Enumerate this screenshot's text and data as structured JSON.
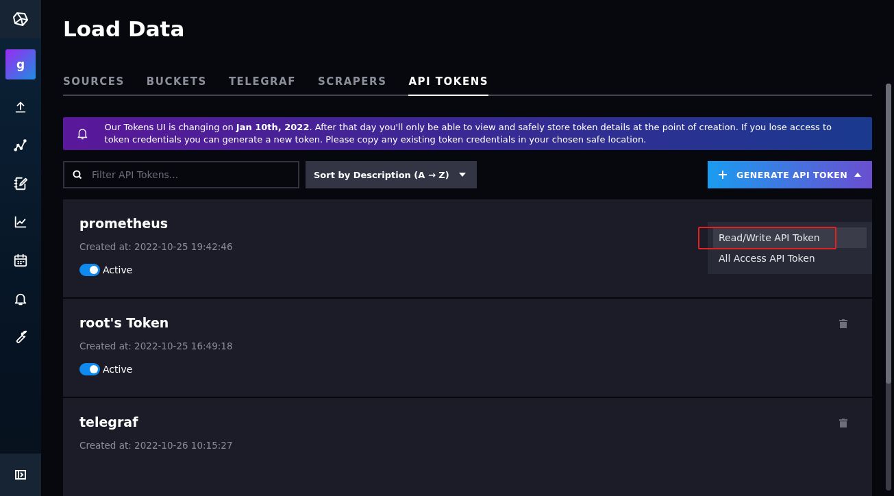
{
  "sidebar": {
    "avatar": "g",
    "items": [
      {
        "kind": "upload",
        "selected": false
      },
      {
        "kind": "graph",
        "selected": false
      },
      {
        "kind": "notebook",
        "selected": false
      },
      {
        "kind": "chart",
        "selected": false
      },
      {
        "kind": "calendar",
        "selected": false
      },
      {
        "kind": "bell",
        "selected": false
      },
      {
        "kind": "wrench",
        "selected": false
      }
    ]
  },
  "page": {
    "title": "Load Data"
  },
  "tabs": [
    {
      "label": "SOURCES",
      "selected": false
    },
    {
      "label": "BUCKETS",
      "selected": false
    },
    {
      "label": "TELEGRAF",
      "selected": false
    },
    {
      "label": "SCRAPERS",
      "selected": false
    },
    {
      "label": "API TOKENS",
      "selected": true
    }
  ],
  "banner": {
    "text": "Our Tokens UI is changing on **Jan 10th, 2022**. After that day you'll only be able to view and safely store token details at the point of creation. If you lose access to token credentials you can generate a new token. Please copy any existing token credentials in your chosen safe location."
  },
  "search": {
    "placeholder": "Filter API Tokens..."
  },
  "sort": {
    "label": "Sort by Description (A → Z)"
  },
  "generate_button": {
    "label": "GENERATE API TOKEN",
    "expanded": true
  },
  "generate_menu": [
    {
      "label": "Read/Write API Token",
      "selected": true,
      "annotated": true
    },
    {
      "label": "All Access API Token",
      "selected": false,
      "annotated": false
    }
  ],
  "tokens": [
    {
      "name": "prometheus",
      "created": "Created at: 2022-10-25 19:42:46",
      "active": true,
      "status": "Active",
      "delete_visible": false
    },
    {
      "name": "root's Token",
      "created": "Created at: 2022-10-25 16:49:18",
      "active": true,
      "status": "Active",
      "delete_visible": true
    },
    {
      "name": "telegraf",
      "created": "Created at: 2022-10-26 10:15:27",
      "delete_visible": true
    }
  ]
}
